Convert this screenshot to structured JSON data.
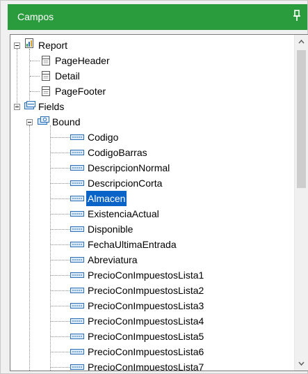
{
  "panel": {
    "title": "Campos",
    "pin_icon": "pin-icon"
  },
  "tree": {
    "report": {
      "label": "Report",
      "icon": "report-icon"
    },
    "report_children": [
      {
        "label": "PageHeader",
        "icon": "section-icon"
      },
      {
        "label": "Detail",
        "icon": "section-icon"
      },
      {
        "label": "PageFooter",
        "icon": "section-icon"
      }
    ],
    "fields": {
      "label": "Fields",
      "icon": "fields-folder-icon"
    },
    "bound": {
      "label": "Bound",
      "icon": "bound-folder-icon"
    },
    "bound_fields": [
      {
        "label": "Codigo"
      },
      {
        "label": "CodigoBarras"
      },
      {
        "label": "DescripcionNormal"
      },
      {
        "label": "DescripcionCorta"
      },
      {
        "label": "Almacen",
        "selected": true
      },
      {
        "label": "ExistenciaActual"
      },
      {
        "label": "Disponible"
      },
      {
        "label": "FechaUltimaEntrada"
      },
      {
        "label": "Abreviatura"
      },
      {
        "label": "PrecioConImpuestosLista1"
      },
      {
        "label": "PrecioConImpuestosLista2"
      },
      {
        "label": "PrecioConImpuestosLista3"
      },
      {
        "label": "PrecioConImpuestosLista4"
      },
      {
        "label": "PrecioConImpuestosLista5"
      },
      {
        "label": "PrecioConImpuestosLista6"
      },
      {
        "label": "PrecioConImpuestosLista7"
      }
    ],
    "field_icon": "field-icon",
    "selection_color": "#0a64c8"
  },
  "colors": {
    "titlebar": "#2b9c3d"
  }
}
